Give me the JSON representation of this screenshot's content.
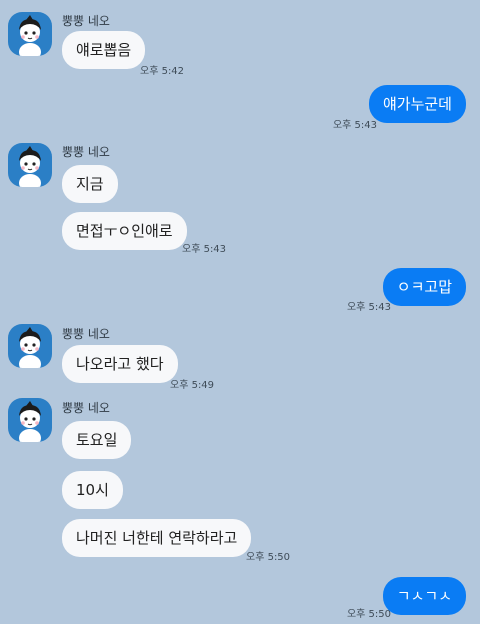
{
  "sender_name": "뿡뿡 네오",
  "messages": [
    {
      "text": "얘로뽑음",
      "time": "오후 5:42"
    },
    {
      "text": "얘가누군데",
      "time": "오후 5:43"
    },
    {
      "text": "지금"
    },
    {
      "text": "면접ㅜㅇ인애로",
      "time": "오후 5:43"
    },
    {
      "text": "ㅇㅋ고맙",
      "time": "오후 5:43"
    },
    {
      "text": "나오라고 했다",
      "time": "오후 5:49"
    },
    {
      "text": "토요일"
    },
    {
      "text": "10시"
    },
    {
      "text": "나머진 너한테 연락하라고",
      "time": "오후 5:50"
    },
    {
      "text": "ㄱㅅㄱㅅ",
      "time": "오후 5:50"
    }
  ],
  "colors": {
    "background": "#b3c7dc",
    "outgoing_bubble": "#0a7cf4",
    "incoming_bubble": "#f7f8fa",
    "avatar_bg": "#2b7fc6"
  }
}
